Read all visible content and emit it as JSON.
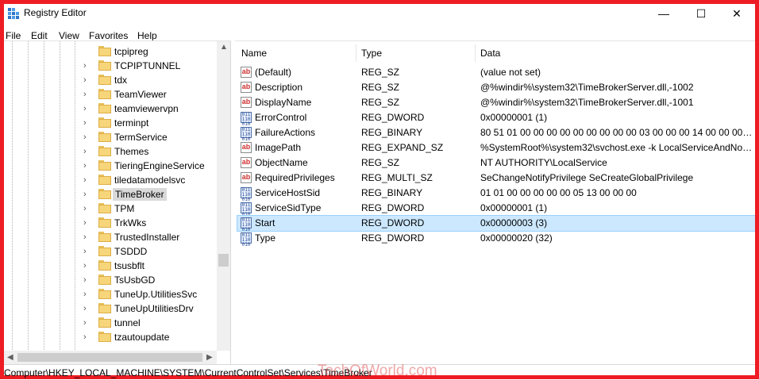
{
  "window": {
    "title": "Registry Editor",
    "minimize_glyph": "—",
    "maximize_glyph": "☐",
    "close_glyph": "✕"
  },
  "menu": [
    "File",
    "Edit",
    "View",
    "Favorites",
    "Help"
  ],
  "tree": {
    "items": [
      {
        "label": "tcpipreg",
        "expandable": false,
        "selected": false
      },
      {
        "label": "TCPIPTUNNEL",
        "expandable": true,
        "selected": false
      },
      {
        "label": "tdx",
        "expandable": true,
        "selected": false
      },
      {
        "label": "TeamViewer",
        "expandable": true,
        "selected": false
      },
      {
        "label": "teamviewervpn",
        "expandable": true,
        "selected": false
      },
      {
        "label": "terminpt",
        "expandable": true,
        "selected": false
      },
      {
        "label": "TermService",
        "expandable": true,
        "selected": false
      },
      {
        "label": "Themes",
        "expandable": true,
        "selected": false
      },
      {
        "label": "TieringEngineService",
        "expandable": true,
        "selected": false
      },
      {
        "label": "tiledatamodelsvc",
        "expandable": true,
        "selected": false
      },
      {
        "label": "TimeBroker",
        "expandable": true,
        "selected": true
      },
      {
        "label": "TPM",
        "expandable": true,
        "selected": false
      },
      {
        "label": "TrkWks",
        "expandable": true,
        "selected": false
      },
      {
        "label": "TrustedInstaller",
        "expandable": true,
        "selected": false
      },
      {
        "label": "TSDDD",
        "expandable": true,
        "selected": false
      },
      {
        "label": "tsusbflt",
        "expandable": true,
        "selected": false
      },
      {
        "label": "TsUsbGD",
        "expandable": true,
        "selected": false
      },
      {
        "label": "TuneUp.UtilitiesSvc",
        "expandable": true,
        "selected": false
      },
      {
        "label": "TuneUpUtilitiesDrv",
        "expandable": true,
        "selected": false
      },
      {
        "label": "tunnel",
        "expandable": true,
        "selected": false
      },
      {
        "label": "tzautoupdate",
        "expandable": true,
        "selected": false
      }
    ]
  },
  "list": {
    "columns": {
      "name": "Name",
      "type": "Type",
      "data": "Data"
    },
    "rows": [
      {
        "icon": "string-value-icon",
        "name": "(Default)",
        "type": "REG_SZ",
        "data": "(value not set)",
        "selected": false
      },
      {
        "icon": "string-value-icon",
        "name": "Description",
        "type": "REG_SZ",
        "data": "@%windir%\\system32\\TimeBrokerServer.dll,-1002",
        "selected": false
      },
      {
        "icon": "string-value-icon",
        "name": "DisplayName",
        "type": "REG_SZ",
        "data": "@%windir%\\system32\\TimeBrokerServer.dll,-1001",
        "selected": false
      },
      {
        "icon": "binary-value-icon",
        "name": "ErrorControl",
        "type": "REG_DWORD",
        "data": "0x00000001 (1)",
        "selected": false
      },
      {
        "icon": "binary-value-icon",
        "name": "FailureActions",
        "type": "REG_BINARY",
        "data": "80 51 01 00 00 00 00 00 00 00 00 00 03 00 00 00 14 00 00 00 01 00 0...",
        "selected": false
      },
      {
        "icon": "string-value-icon",
        "name": "ImagePath",
        "type": "REG_EXPAND_SZ",
        "data": "%SystemRoot%\\system32\\svchost.exe -k LocalServiceAndNoIm...",
        "selected": false
      },
      {
        "icon": "string-value-icon",
        "name": "ObjectName",
        "type": "REG_SZ",
        "data": "NT AUTHORITY\\LocalService",
        "selected": false
      },
      {
        "icon": "string-value-icon",
        "name": "RequiredPrivileges",
        "type": "REG_MULTI_SZ",
        "data": "SeChangeNotifyPrivilege SeCreateGlobalPrivilege",
        "selected": false
      },
      {
        "icon": "binary-value-icon",
        "name": "ServiceHostSid",
        "type": "REG_BINARY",
        "data": "01 01 00 00 00 00 00 05 13 00 00 00",
        "selected": false
      },
      {
        "icon": "binary-value-icon",
        "name": "ServiceSidType",
        "type": "REG_DWORD",
        "data": "0x00000001 (1)",
        "selected": false
      },
      {
        "icon": "binary-value-icon",
        "name": "Start",
        "type": "REG_DWORD",
        "data": "0x00000003 (3)",
        "selected": true
      },
      {
        "icon": "binary-value-icon",
        "name": "Type",
        "type": "REG_DWORD",
        "data": "0x00000020 (32)",
        "selected": false
      }
    ]
  },
  "statusbar": {
    "path": "Computer\\HKEY_LOCAL_MACHINE\\SYSTEM\\CurrentControlSet\\Services\\TimeBroker"
  },
  "watermark": "TechOfWorld.com",
  "colors": {
    "frame_border": "#ee1c24",
    "selection_bg": "#cce8ff",
    "tree_selection_bg": "#d9d9d9"
  }
}
